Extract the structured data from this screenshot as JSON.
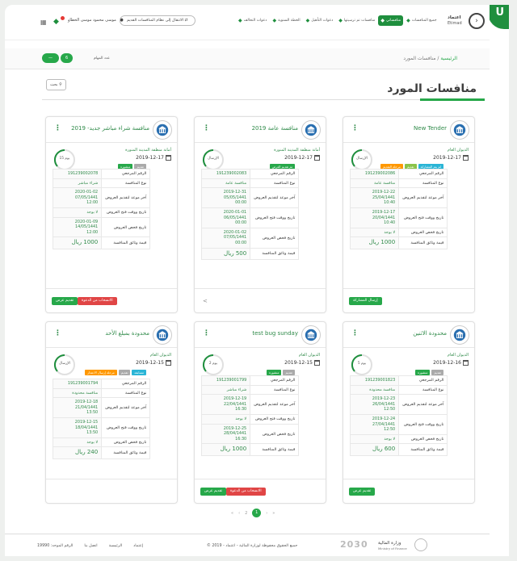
{
  "topbar": {
    "user": "موسى محمود موسى الخطاو",
    "switch_label": "الانتقال إلى نظام المنافسات القديم",
    "nav": [
      {
        "label": "دعوات التحالف"
      },
      {
        "label": "الخطة السنوية"
      },
      {
        "label": "دعوات التأهيل"
      },
      {
        "label": "منافسات تم ترسيتها"
      },
      {
        "label": "منافساتي"
      },
      {
        "label": "جميع المنافسات"
      }
    ],
    "logo_ar": "اعتماد",
    "logo_en": "Etimad"
  },
  "subbar": {
    "toggle_label": "—",
    "count_value": "6",
    "count_label": "عدد المهام",
    "breadcrumb_home": "الرئيسية",
    "breadcrumb_sep": " / ",
    "breadcrumb_current": "منافسات المورد"
  },
  "page_title": "منافسات المورد",
  "search_label": "بحث",
  "labels": {
    "ref": "الرقم المرجعي",
    "type": "نوع المنافسة",
    "last_offer": "آخر موعد لتقديم العروض",
    "open_date": "تاريخ ووقت فتح العروض",
    "exam_date": "تاريخ فحص العروض",
    "doc_price": "قيمة وثائق المنافسة"
  },
  "cards": [
    {
      "title": "New Tender",
      "org": "الديوان العام",
      "date": "2019-12-17",
      "ring": "الإرسال",
      "badges": [
        {
          "t": "لم يتم المشاركة",
          "c": "#2ab5d6"
        },
        {
          "t": "تقديم",
          "c": "#8bc34a"
        },
        {
          "t": "مرحلة التقديم",
          "c": "#ff9800"
        }
      ],
      "rows": [
        [
          "ref",
          "191239002086"
        ],
        [
          "type",
          "منافسة عامة"
        ],
        [
          "last_offer",
          "2019-12-22\n25/04/1441\n10:40"
        ],
        [
          "open_date",
          "2019-12-17\n20/04/1441\n10:40"
        ],
        [
          "exam_date",
          "لا يوجد"
        ],
        [
          "doc_price",
          "1000 ريال"
        ]
      ],
      "share": true,
      "buttons": [
        {
          "t": "إرسال المشاركة",
          "c": "green"
        }
      ]
    },
    {
      "title": "منافسة عامة 2019",
      "org": "أمانة منطقة المدينة المنورة",
      "date": "2019-12-17",
      "ring": "الإرسال",
      "badges": [
        {
          "t": "تم تقديم العرض",
          "c": "#27a84a"
        }
      ],
      "rows": [
        [
          "ref",
          "191239002083"
        ],
        [
          "type",
          "منافسة عامة"
        ],
        [
          "last_offer",
          "2019-12-31\n05/05/1441\n00:00"
        ],
        [
          "open_date",
          "2020-01-01\n06/05/1441\n00:00"
        ],
        [
          "exam_date",
          "2020-01-02\n07/05/1441\n00:00"
        ],
        [
          "doc_price",
          "500 ريال"
        ]
      ],
      "share": true,
      "buttons": []
    },
    {
      "title": "منافسة شراء مباشر جديد- 2019",
      "org": "أمانة منطقة المدينة المنورة",
      "date": "2019-12-17",
      "ring": "15 يوم",
      "badges": [
        {
          "t": "تقديم",
          "c": "#aaaaaa"
        },
        {
          "t": "منشورة",
          "c": "#27a84a"
        }
      ],
      "rows": [
        [
          "ref",
          "191239002078"
        ],
        [
          "type",
          "شراء مباشر"
        ],
        [
          "last_offer",
          "2020-01-02\n07/05/1441\n12:00"
        ],
        [
          "open_date",
          "لا يوجد"
        ],
        [
          "exam_date",
          "2020-01-09\n14/05/1441\n12:00"
        ],
        [
          "doc_price",
          "1000 ريال"
        ]
      ],
      "share": false,
      "buttons": [
        {
          "t": "الانسحاب من الدعوة",
          "c": "red"
        },
        {
          "t": "تقديم عرض",
          "c": "green"
        }
      ]
    },
    {
      "title": "محدودة الاثنين",
      "org": "الديوان العام",
      "date": "2019-12-16",
      "ring": "5 يوم",
      "badges": [
        {
          "t": "تقديم",
          "c": "#aaaaaa"
        },
        {
          "t": "منشورة",
          "c": "#27a84a"
        }
      ],
      "rows": [
        [
          "ref",
          "191239001823"
        ],
        [
          "type",
          "منافسة محدودة"
        ],
        [
          "last_offer",
          "2019-12-23\n26/04/1441\n12:50"
        ],
        [
          "open_date",
          "2019-12-24\n27/04/1441\n12:50"
        ],
        [
          "exam_date",
          "لا يوجد"
        ],
        [
          "doc_price",
          "600 ريال"
        ]
      ],
      "share": false,
      "buttons": [
        {
          "t": "تقديم عرض",
          "c": "green"
        }
      ]
    },
    {
      "title": "test bug sunday",
      "org": "الديوان العام",
      "date": "2019-12-15",
      "ring": "2 يوم",
      "badges": [
        {
          "t": "تقديم",
          "c": "#aaaaaa"
        },
        {
          "t": "منشورة",
          "c": "#27a84a"
        }
      ],
      "rows": [
        [
          "ref",
          "191239001799"
        ],
        [
          "type",
          "شراء مباشر"
        ],
        [
          "last_offer",
          "2019-12-19\n22/04/1441\n16:30"
        ],
        [
          "open_date",
          "لا يوجد"
        ],
        [
          "exam_date",
          "2019-12-25\n28/04/1441\n16:30"
        ],
        [
          "doc_price",
          "1000 ريال"
        ]
      ],
      "share": false,
      "buttons": [
        {
          "t": "الانسحاب من الدعوة",
          "c": "red"
        },
        {
          "t": "تقديم عرض",
          "c": "green"
        }
      ]
    },
    {
      "title": "محدودة بمبلغ الأحد",
      "org": "الديوان العام",
      "date": "2019-12-15",
      "ring": "الإرسال",
      "badges": [
        {
          "t": "مسابقه",
          "c": "#2ab5d6"
        },
        {
          "t": "تقديم",
          "c": "#aaaaaa"
        },
        {
          "t": "مرحلة إرسال الاعتذار",
          "c": "#ff9800"
        }
      ],
      "rows": [
        [
          "ref",
          "191239001794"
        ],
        [
          "type",
          "منافسة محدودة"
        ],
        [
          "last_offer",
          "2019-12-18\n21/04/1441\n13:50"
        ],
        [
          "open_date",
          "2019-12-15\n18/04/1441\n13:50"
        ],
        [
          "exam_date",
          "لا يوجد"
        ],
        [
          "doc_price",
          "240 ريال"
        ]
      ],
      "share": false,
      "buttons": []
    }
  ],
  "pager": {
    "first": "«",
    "prev": "‹",
    "p2": "2",
    "p1": "1",
    "next": "›",
    "last": "»"
  },
  "footer": {
    "links": [
      "اتصل بنا",
      "الرئيسية",
      "إعتماد"
    ],
    "unified": "الرقم الموحد: 19990",
    "copyright": "جميع الحقوق محفوظة لوزارة المالية - اعتماد - 2019 ©",
    "vision": "2030",
    "ministry_ar": "وزارة المالية",
    "ministry_en": "Ministry of Finance"
  }
}
